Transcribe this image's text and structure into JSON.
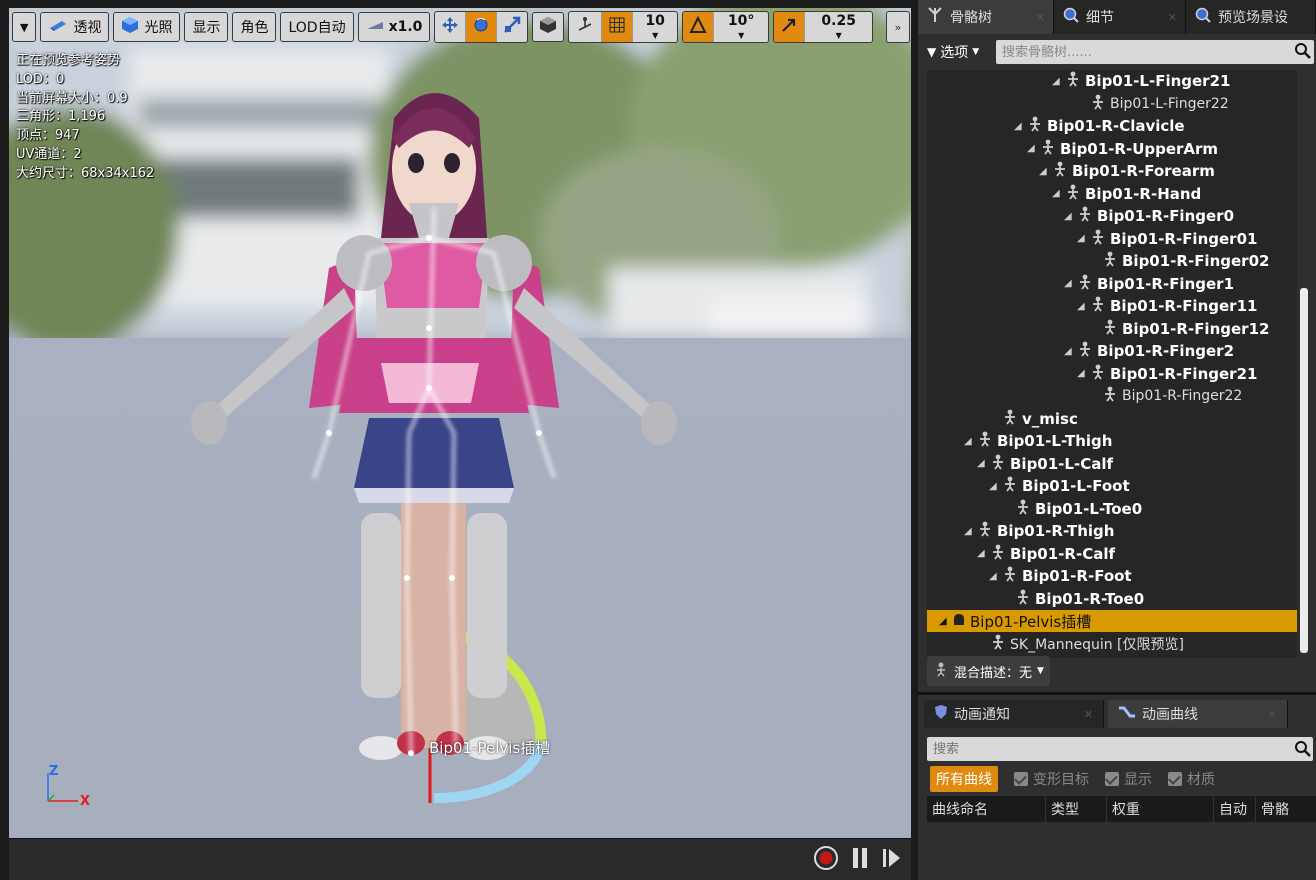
{
  "toolbar": {
    "menu_arrow": "▼",
    "perspective": "透视",
    "lit": "光照",
    "show": "显示",
    "character": "角色",
    "lod": "LOD自动",
    "speed": "x1.0",
    "grid_size": "10",
    "rotation_snap": "10°",
    "scale_snap": "0.25",
    "expand": "»"
  },
  "info": {
    "line1": "正在预览参考姿势",
    "line2": "LOD：0",
    "line3": "当前屏幕大小：0.9",
    "line4": "三角形：1,196",
    "line5": "顶点：947",
    "line6": "UV通道：2",
    "line7": "大约尺寸：68x34x162"
  },
  "viewport": {
    "socket_label": "Bip01-Pelvis插槽",
    "axis_z": "Z",
    "axis_x": "X"
  },
  "right_tabs": {
    "skeleton": "骨骼树",
    "details": "细节",
    "preview": "预览场景设"
  },
  "tree_toolbar": {
    "options": "选项",
    "search_placeholder": "搜索骨骼树......"
  },
  "tree": [
    {
      "label": "Bip01-L-Finger21",
      "expanded": true,
      "leaf": false
    },
    {
      "label": "Bip01-L-Finger22",
      "expanded": false,
      "leaf": true
    },
    {
      "label": "Bip01-R-Clavicle",
      "expanded": true,
      "leaf": false
    },
    {
      "label": "Bip01-R-UpperArm",
      "expanded": true,
      "leaf": false
    },
    {
      "label": "Bip01-R-Forearm",
      "expanded": true,
      "leaf": false
    },
    {
      "label": "Bip01-R-Hand",
      "expanded": true,
      "leaf": false
    },
    {
      "label": "Bip01-R-Finger0",
      "expanded": true,
      "leaf": false
    },
    {
      "label": "Bip01-R-Finger01",
      "expanded": true,
      "leaf": false
    },
    {
      "label": "Bip01-R-Finger02",
      "expanded": false,
      "leaf": false
    },
    {
      "label": "Bip01-R-Finger1",
      "expanded": true,
      "leaf": false
    },
    {
      "label": "Bip01-R-Finger11",
      "expanded": true,
      "leaf": false
    },
    {
      "label": "Bip01-R-Finger12",
      "expanded": false,
      "leaf": false
    },
    {
      "label": "Bip01-R-Finger2",
      "expanded": true,
      "leaf": false
    },
    {
      "label": "Bip01-R-Finger21",
      "expanded": true,
      "leaf": false
    },
    {
      "label": "Bip01-R-Finger22",
      "expanded": false,
      "leaf": true
    },
    {
      "label": "v_misc",
      "expanded": false,
      "leaf": false
    },
    {
      "label": "Bip01-L-Thigh",
      "expanded": true,
      "leaf": false
    },
    {
      "label": "Bip01-L-Calf",
      "expanded": true,
      "leaf": false
    },
    {
      "label": "Bip01-L-Foot",
      "expanded": true,
      "leaf": false
    },
    {
      "label": "Bip01-L-Toe0",
      "expanded": false,
      "leaf": false
    },
    {
      "label": "Bip01-R-Thigh",
      "expanded": true,
      "leaf": false
    },
    {
      "label": "Bip01-R-Calf",
      "expanded": true,
      "leaf": false
    },
    {
      "label": "Bip01-R-Foot",
      "expanded": true,
      "leaf": false
    },
    {
      "label": "Bip01-R-Toe0",
      "expanded": false,
      "leaf": false
    },
    {
      "label": "Bip01-Pelvis插槽",
      "expanded": true,
      "leaf": false,
      "selected": true
    },
    {
      "label": "SK_Mannequin [仅限预览]",
      "expanded": false,
      "leaf": true
    }
  ],
  "blend": {
    "label": "混合描述：无"
  },
  "curve_tabs": {
    "notify": "动画通知",
    "curves": "动画曲线"
  },
  "curves": {
    "search_placeholder": "搜索",
    "all_curves": "所有曲线",
    "morph_target": "变形目标",
    "display": "显示",
    "material": "材质"
  },
  "curve_table": {
    "col_name": "曲线命名",
    "col_type": "类型",
    "col_weight": "权重",
    "col_auto": "自动",
    "col_bone": "骨骼"
  },
  "colors": {
    "accent_orange": "#e08a12",
    "selected_row": "#d99a00"
  }
}
